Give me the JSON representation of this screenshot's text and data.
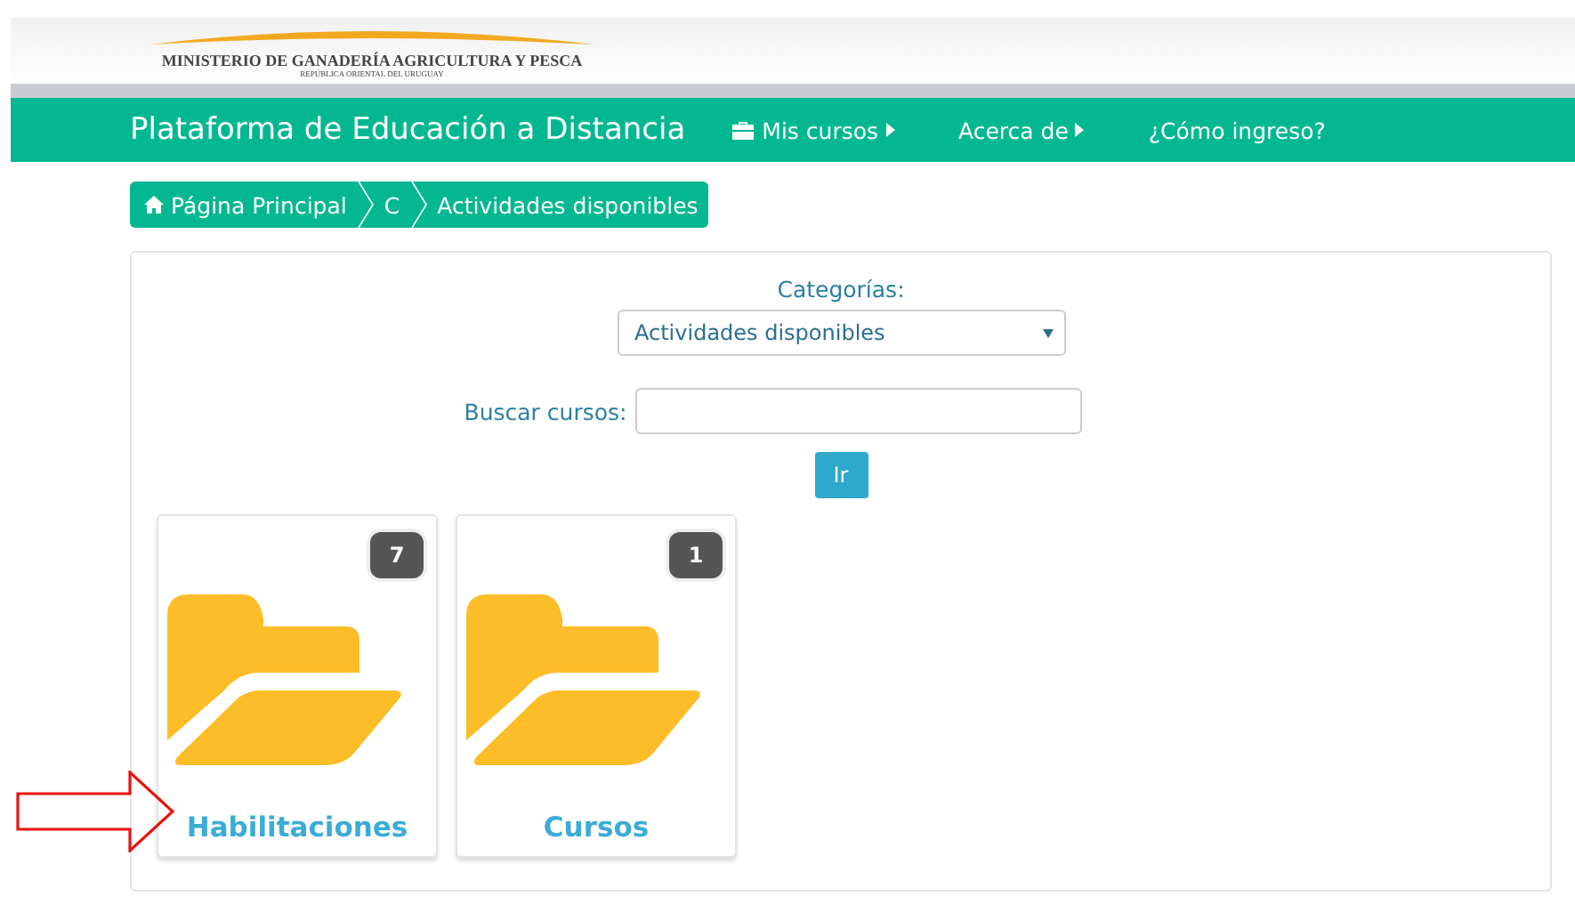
{
  "header": {
    "ministry": "MINISTERIO DE GANADERÍA AGRICULTURA Y PESCA",
    "country": "REPÚBLICA ORIENTAL DEL URUGUAY"
  },
  "navbar": {
    "title": "Plataforma de Educación a Distancia",
    "items": [
      {
        "label": "Mis cursos",
        "kind": "icon-menu"
      },
      {
        "label": "Acerca de",
        "kind": "menu"
      },
      {
        "label": "¿Cómo ingreso?",
        "kind": "link"
      }
    ]
  },
  "breadcrumb": [
    {
      "label": "Página Principal",
      "kind": "home"
    },
    {
      "label": "C",
      "kind": "crumb"
    },
    {
      "label": "Actividades disponibles",
      "kind": "crumb"
    }
  ],
  "filter": {
    "label": "Categorías:",
    "value": "Actividades disponibles"
  },
  "search": {
    "label": "Buscar cursos:",
    "button": "Ir"
  },
  "categories": [
    {
      "name": "Habilitaciones",
      "count": "7"
    },
    {
      "name": "Cursos",
      "count": "1"
    }
  ]
}
